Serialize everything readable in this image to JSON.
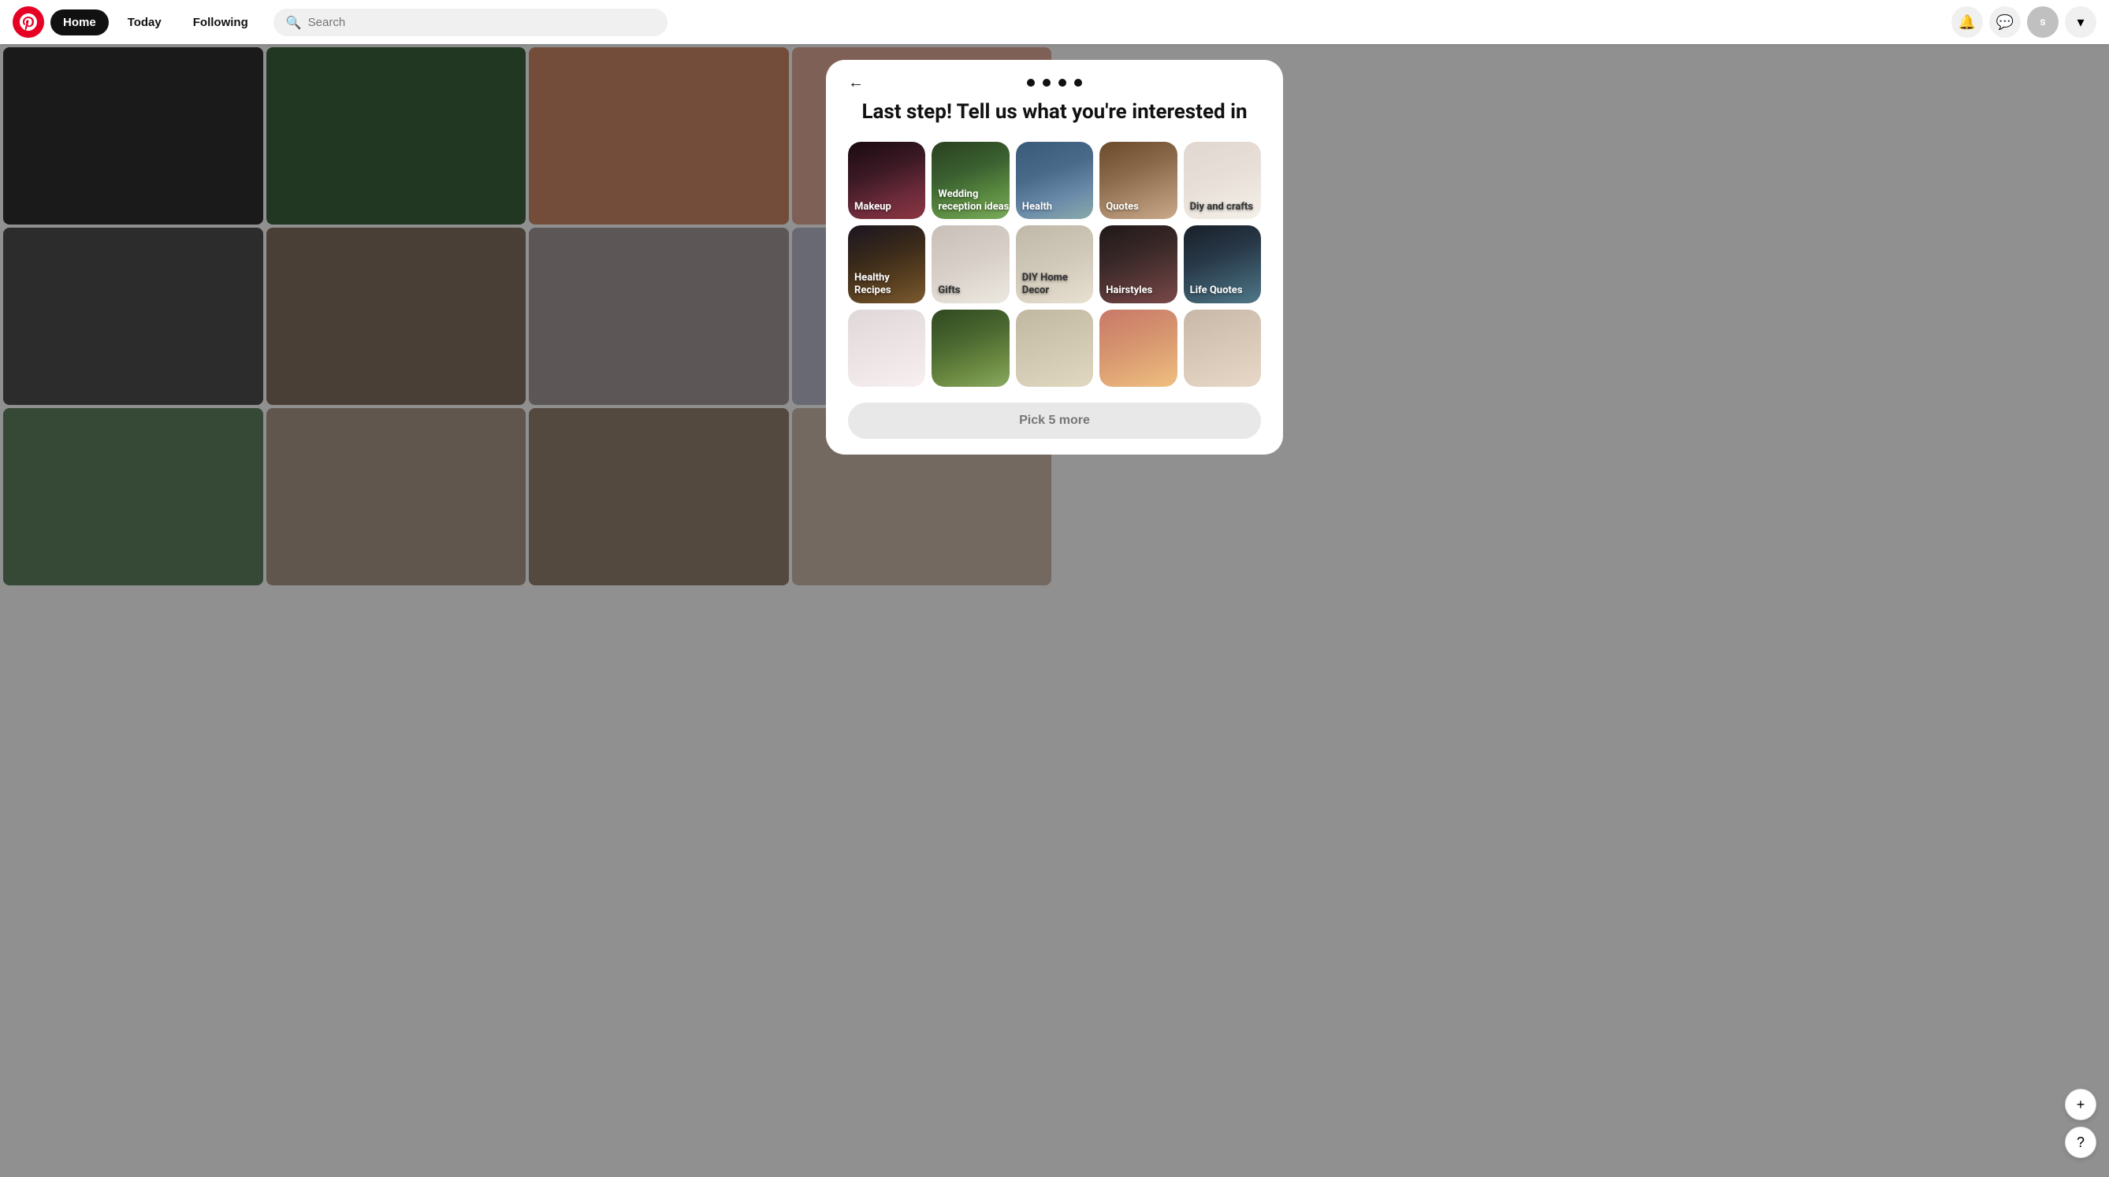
{
  "nav": {
    "logo": "P",
    "home_label": "Home",
    "today_label": "Today",
    "following_label": "Following",
    "search_placeholder": "Search",
    "avatar_letter": "s",
    "chevron": "▾"
  },
  "modal": {
    "title": "Last step! Tell us what you're interested in",
    "back_arrow": "←",
    "dots": [
      {
        "active": true
      },
      {
        "active": true
      },
      {
        "active": true
      },
      {
        "active": true
      }
    ],
    "pick_more_label": "Pick 5 more",
    "cards": [
      {
        "id": "makeup",
        "label": "Makeup",
        "theme": "card-makeup"
      },
      {
        "id": "wedding",
        "label": "Wedding reception ideas",
        "theme": "card-wedding"
      },
      {
        "id": "health",
        "label": "Health",
        "theme": "card-health"
      },
      {
        "id": "quotes",
        "label": "Quotes",
        "theme": "card-quotes"
      },
      {
        "id": "diy",
        "label": "Diy and crafts",
        "theme": "card-diy"
      },
      {
        "id": "recipes",
        "label": "Healthy Recipes",
        "theme": "card-recipes"
      },
      {
        "id": "gifts",
        "label": "Gifts",
        "theme": "card-gifts"
      },
      {
        "id": "diy-home",
        "label": "DIY Home Decor",
        "theme": "card-diy-home"
      },
      {
        "id": "hairstyles",
        "label": "Hairstyles",
        "theme": "card-hairstyles"
      },
      {
        "id": "life-quotes",
        "label": "Life Quotes",
        "theme": "card-life-quotes"
      },
      {
        "id": "skincare",
        "label": "",
        "theme": "card-skincare"
      },
      {
        "id": "pets",
        "label": "",
        "theme": "card-pets"
      },
      {
        "id": "drinks",
        "label": "",
        "theme": "card-drinks"
      },
      {
        "id": "food",
        "label": "",
        "theme": "card-food"
      },
      {
        "id": "hands",
        "label": "",
        "theme": "card-hands"
      }
    ]
  },
  "fab": {
    "plus_icon": "+",
    "question_icon": "?"
  }
}
